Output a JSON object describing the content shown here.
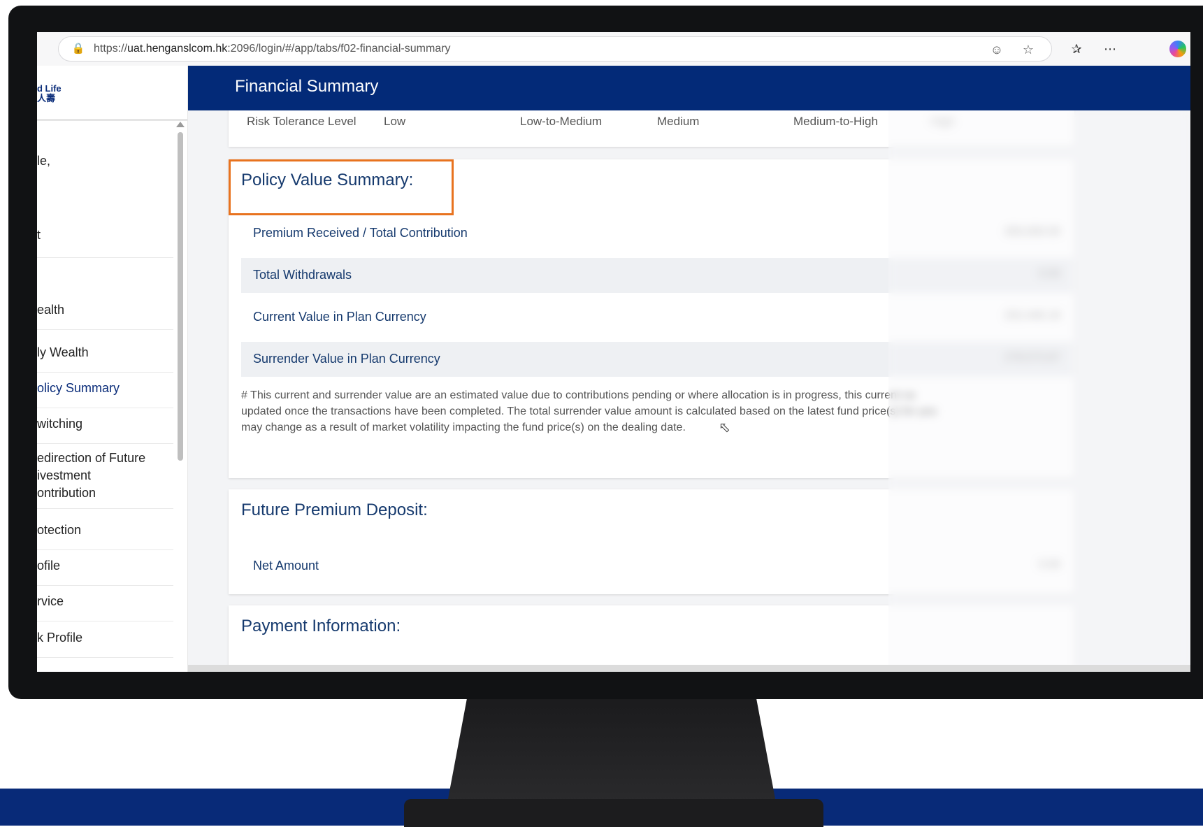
{
  "browser": {
    "url_prefix": "https://",
    "url_host": "uat.henganslcom.hk",
    "url_path": ":2096/login/#/app/tabs/f02-financial-summary"
  },
  "sidebar": {
    "logo_line1": "d Life",
    "logo_line2": "人壽",
    "items": [
      {
        "label": "le,"
      },
      {
        "label": "t"
      },
      {
        "label": "ealth"
      },
      {
        "label": "ly Wealth"
      },
      {
        "label": "olicy Summary"
      },
      {
        "label": "witching"
      },
      {
        "label": "edirection of Future"
      },
      {
        "label": "ivestment"
      },
      {
        "label": "ontribution"
      },
      {
        "label": "otection"
      },
      {
        "label": "ofile"
      },
      {
        "label": "rvice"
      },
      {
        "label": "k Profile"
      }
    ]
  },
  "header": {
    "title": "Financial Summary"
  },
  "risk": {
    "label": "Risk Tolerance Level",
    "levels": [
      "Low",
      "Low-to-Medium",
      "Medium",
      "Medium-to-High",
      "High"
    ]
  },
  "policy_value": {
    "title": "Policy Value Summary:",
    "rows": [
      {
        "label": "Premium Received / Total Contribution",
        "value": "300,000.00"
      },
      {
        "label": "Total Withdrawals",
        "value": "0.00"
      },
      {
        "label": "Current Value in Plan Currency",
        "value": "252,446.18"
      },
      {
        "label": "Surrender Value in Plan Currency",
        "value": "278,573.87"
      }
    ],
    "note_line1": "# This current and surrender value are an estimated value due to contributions pending or where allocation is in progress, this current va",
    "note_line2": "updated once the transactions have been completed. The total surrender value amount is calculated based on the latest fund price(s) for you",
    "note_line3": "may change as a result of market volatility impacting the fund price(s) on the dealing date."
  },
  "future_premium": {
    "title": "Future Premium Deposit:",
    "net_label": "Net Amount",
    "net_value": "0.00"
  },
  "payment": {
    "title": "Payment Information:"
  },
  "colors": {
    "header": "#032a78",
    "highlight": "#e8731f",
    "label": "#163a6e"
  }
}
